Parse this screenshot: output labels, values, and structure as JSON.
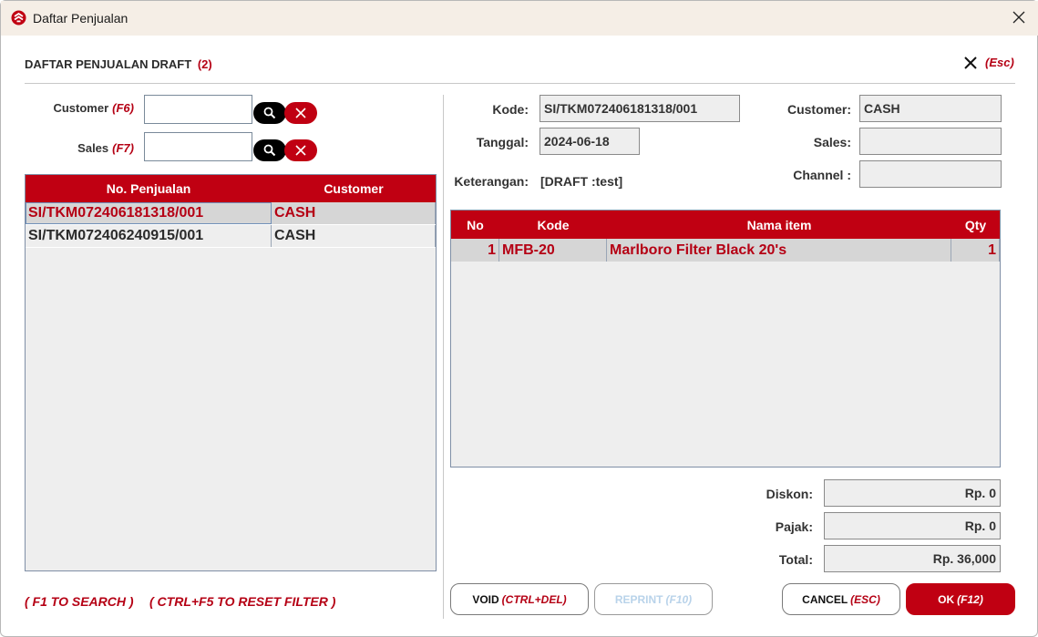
{
  "window": {
    "title": "Daftar Penjualan",
    "icon": "app-logo-icon",
    "close_icon": "close-icon"
  },
  "header": {
    "title": "DAFTAR PENJUALAN DRAFT",
    "count": "(2)",
    "close_shortcut": "(Esc)"
  },
  "filters": {
    "customer_label": "Customer",
    "customer_key": "(F6)",
    "customer_value": "",
    "sales_label": "Sales",
    "sales_key": "(F7)",
    "sales_value": ""
  },
  "sales_list": {
    "columns": [
      "No. Penjualan",
      "Customer"
    ],
    "rows": [
      {
        "no": "SI/TKM072406181318/001",
        "customer": "CASH",
        "selected": true
      },
      {
        "no": "SI/TKM072406240915/001",
        "customer": "CASH",
        "selected": false
      }
    ]
  },
  "detail": {
    "kode_label": "Kode:",
    "kode_value": "SI/TKM072406181318/001",
    "tanggal_label": "Tanggal:",
    "tanggal_value": "2024-06-18",
    "keterangan_label": "Keterangan:",
    "keterangan_value": "[DRAFT :test]",
    "customer_label": "Customer:",
    "customer_value": "CASH",
    "sales_label": "Sales:",
    "sales_value": "",
    "channel_label": "Channel :",
    "channel_value": ""
  },
  "items": {
    "columns": [
      "No",
      "Kode",
      "Nama item",
      "Qty"
    ],
    "rows": [
      {
        "no": "1",
        "kode": "MFB-20",
        "nama": "Marlboro Filter Black 20's",
        "qty": "1"
      }
    ]
  },
  "totals": {
    "diskon_label": "Diskon:",
    "diskon_value": "Rp. 0",
    "pajak_label": "Pajak:",
    "pajak_value": "Rp. 0",
    "total_label": "Total:",
    "total_value": "Rp. 36,000"
  },
  "hints": {
    "search": "( F1 TO SEARCH )",
    "reset": "( CTRL+F5 TO RESET FILTER )"
  },
  "buttons": {
    "void_label": "VOID",
    "void_key": "(CTRL+DEL)",
    "reprint_label": "REPRINT",
    "reprint_key": "(F10)",
    "cancel_label": "CANCEL",
    "cancel_key": "(ESC)",
    "ok_label": "OK",
    "ok_key": "(F12)"
  },
  "colors": {
    "accent": "#c00012",
    "accent_text": "#b50014",
    "titlebar": "#f5eee6",
    "field_bg": "#eeeeee",
    "selected_row": "#d6d6d6"
  }
}
